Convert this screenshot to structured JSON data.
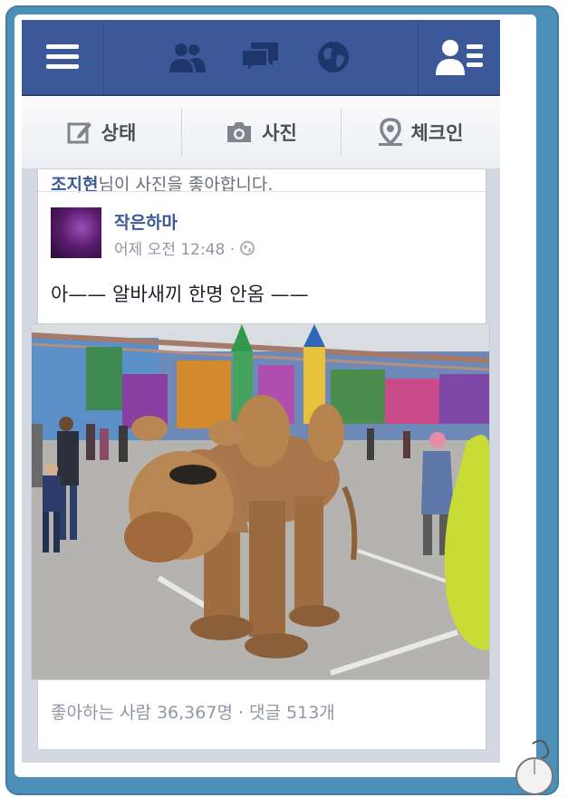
{
  "top_nav": {
    "menu_icon": "hamburger-menu-icon",
    "friend_requests_icon": "friends-icon",
    "messages_icon": "messages-icon",
    "notifications_icon": "globe-icon",
    "friends_list_icon": "friends-list-icon"
  },
  "composer": {
    "status_label": "상태",
    "photo_label": "사진",
    "checkin_label": "체크인"
  },
  "feed": {
    "previous_story_text": "님이 사진을 좋아합니다.",
    "previous_story_name": "조지현",
    "post": {
      "author": "작은하마",
      "timestamp": "어제 오전 12:48 ·",
      "privacy_icon": "globe-icon",
      "text": "아—— 알바새끼 한명 안옴 ——",
      "likes_comments": "좋아하는 사람 36,367명 · 댓글 513개"
    }
  },
  "colors": {
    "nav_blue": "#3b5998",
    "frame_blue": "#4c8fb8",
    "link_blue": "#3b5998",
    "meta_gray": "#9197a3"
  }
}
